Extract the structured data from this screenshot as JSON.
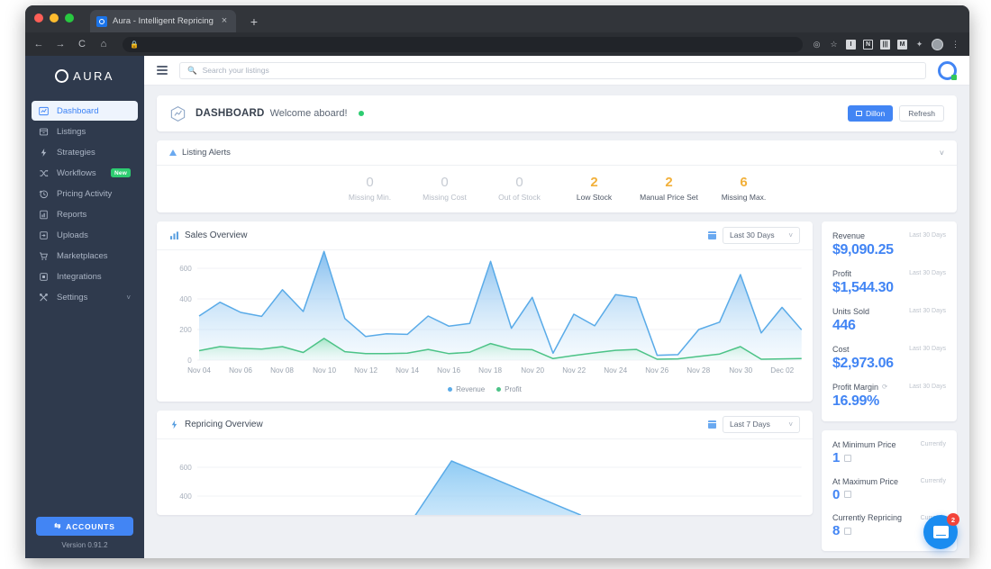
{
  "browser": {
    "tab_title": "Aura - Intelligent Repricing",
    "tab_close": "×",
    "new_tab": "+",
    "back": "←",
    "forward": "→",
    "reload": "C",
    "home": "⌂",
    "lock": "🔒",
    "toolbar_icons": [
      "target-icon",
      "star-icon",
      "info-extension-icon",
      "image-extension-icon",
      "book-extension-icon",
      "m-extension-icon",
      "puzzle-extension-icon",
      "profile-avatar-icon",
      "menu-kebab-icon"
    ],
    "extension_letters": {
      "info": "I",
      "note": "N",
      "book": "|||",
      "m": "M",
      "puzzle": "✦"
    },
    "kebab": "⋮"
  },
  "sidebar": {
    "brand": "AURA",
    "items": [
      {
        "label": "Dashboard",
        "icon": "chart-line-icon",
        "active": true
      },
      {
        "label": "Listings",
        "icon": "archive-icon",
        "active": false
      },
      {
        "label": "Strategies",
        "icon": "bolt-icon",
        "active": false
      },
      {
        "label": "Workflows",
        "icon": "shuffle-icon",
        "active": false,
        "badge": "New"
      },
      {
        "label": "Pricing Activity",
        "icon": "history-clock-icon",
        "active": false
      },
      {
        "label": "Reports",
        "icon": "report-bars-icon",
        "active": false
      },
      {
        "label": "Uploads",
        "icon": "upload-icon",
        "active": false
      },
      {
        "label": "Marketplaces",
        "icon": "shopping-cart-icon",
        "active": false
      },
      {
        "label": "Integrations",
        "icon": "square-module-icon",
        "active": false
      },
      {
        "label": "Settings",
        "icon": "tools-icon",
        "active": false,
        "caret": "˅"
      }
    ],
    "accounts_button": "ACCOUNTS",
    "version": "Version 0.91.2"
  },
  "appbar": {
    "search_placeholder": "Search your listings",
    "search_value": ""
  },
  "dashboard_header": {
    "title": "DASHBOARD",
    "subtitle": "Welcome aboard!",
    "user_button": "Dillon",
    "refresh_button": "Refresh"
  },
  "listing_alerts": {
    "title": "Listing Alerts",
    "collapse_caret": "˅",
    "stats": [
      {
        "value": "0",
        "label": "Missing Min.",
        "warn": false
      },
      {
        "value": "0",
        "label": "Missing Cost",
        "warn": false
      },
      {
        "value": "0",
        "label": "Out of Stock",
        "warn": false
      },
      {
        "value": "2",
        "label": "Low Stock",
        "warn": true
      },
      {
        "value": "2",
        "label": "Manual Price Set",
        "warn": true
      },
      {
        "value": "6",
        "label": "Missing Max.",
        "warn": true
      }
    ]
  },
  "sales_overview": {
    "title": "Sales Overview",
    "range": "Last 30 Days",
    "caret": "˅"
  },
  "repricing_overview": {
    "title": "Repricing Overview",
    "range": "Last 7 Days",
    "caret": "˅"
  },
  "metrics": [
    {
      "name": "Revenue",
      "period": "Last 30 Days",
      "value": "$9,090.25"
    },
    {
      "name": "Profit",
      "period": "Last 30 Days",
      "value": "$1,544.30"
    },
    {
      "name": "Units Sold",
      "period": "Last 30 Days",
      "value": "446"
    },
    {
      "name": "Cost",
      "period": "Last 30 Days",
      "value": "$2,973.06"
    },
    {
      "name": "Profit Margin",
      "period": "Last 30 Days",
      "value": "16.99%",
      "refresh_icon": "⟳"
    }
  ],
  "price_status": [
    {
      "name": "At Minimum Price",
      "period": "Currently",
      "value": "1"
    },
    {
      "name": "At Maximum Price",
      "period": "Currently",
      "value": "0"
    },
    {
      "name": "Currently Repricing",
      "period": "Currently",
      "value": "8"
    }
  ],
  "chat": {
    "unread": "2"
  },
  "colors": {
    "accent_blue": "#4285f4",
    "revenue_line": "#5aabe8",
    "profit_line": "#4cc387",
    "warn_amber": "#f2b03a",
    "sidebar_bg": "#2f3a4d",
    "page_bg": "#eef0f4"
  },
  "chart_data": [
    {
      "type": "area",
      "title": "Sales Overview",
      "xlabel": "",
      "ylabel": "",
      "ylim": [
        0,
        720
      ],
      "yticks": [
        0,
        200,
        400,
        600
      ],
      "grid": true,
      "legend_position": "bottom",
      "x": [
        "Nov 04",
        "Nov 05",
        "Nov 06",
        "Nov 07",
        "Nov 08",
        "Nov 09",
        "Nov 10",
        "Nov 11",
        "Nov 12",
        "Nov 13",
        "Nov 14",
        "Nov 15",
        "Nov 16",
        "Nov 17",
        "Nov 18",
        "Nov 19",
        "Nov 20",
        "Nov 21",
        "Nov 22",
        "Nov 23",
        "Nov 24",
        "Nov 25",
        "Nov 26",
        "Nov 27",
        "Nov 28",
        "Nov 29",
        "Nov 30",
        "Dec 01",
        "Dec 02",
        "Dec 03"
      ],
      "tick_labels": [
        "Nov 04",
        "Nov 06",
        "Nov 08",
        "Nov 10",
        "Nov 12",
        "Nov 14",
        "Nov 16",
        "Nov 18",
        "Nov 20",
        "Nov 22",
        "Nov 24",
        "Nov 26",
        "Nov 28",
        "Nov 30",
        "Dec 02"
      ],
      "series": [
        {
          "name": "Revenue",
          "color": "#5aabe8",
          "values": [
            288,
            378,
            312,
            286,
            460,
            318,
            710,
            272,
            178,
            196,
            192,
            312,
            222,
            240,
            645,
            208,
            410,
            45,
            300,
            530,
            428,
            408,
            32,
            36,
            200,
            248,
            558,
            178,
            345,
            198
          ]
        },
        {
          "name": "Profit",
          "color": "#4cc387",
          "values": [
            62,
            88,
            78,
            72,
            88,
            50,
            142,
            55,
            42,
            42,
            46,
            70,
            42,
            52,
            108,
            72,
            68,
            10,
            30,
            48,
            64,
            70,
            6,
            8,
            24,
            40,
            88,
            6,
            8,
            10
          ]
        }
      ]
    },
    {
      "type": "area",
      "title": "Repricing Overview",
      "xlabel": "",
      "ylabel": "",
      "ylim": [
        0,
        780
      ],
      "yticks": [
        400,
        600
      ],
      "grid": true,
      "series": [
        {
          "name": "Repricing",
          "color": "#6ab7ef",
          "values": [
            0,
            0,
            0,
            660,
            300,
            0,
            0
          ]
        }
      ]
    }
  ]
}
